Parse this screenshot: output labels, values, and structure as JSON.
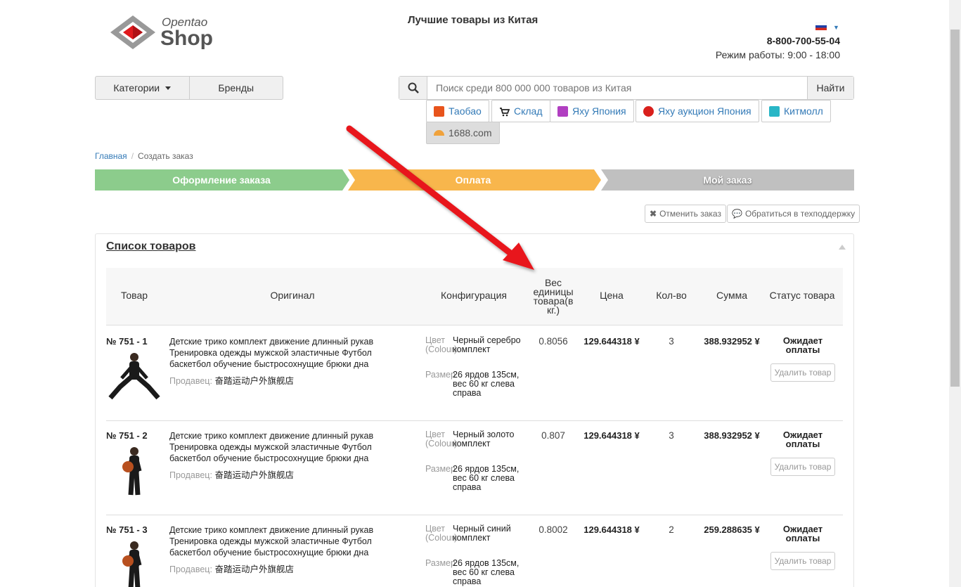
{
  "header": {
    "logo_top": "Opentao",
    "logo_main": "Shop",
    "tagline": "Лучшие товары из Китая",
    "phone": "8-800-700-55-04",
    "hours": "Режим работы: 9:00 - 18:00"
  },
  "nav": {
    "categories": "Категории",
    "brands": "Бренды"
  },
  "search": {
    "placeholder": "Поиск среди 800 000 000 товаров из Китая",
    "button": "Найти"
  },
  "sources": [
    {
      "label": "Таобао",
      "color": "#e8541c"
    },
    {
      "label": "Склад",
      "color": "#333333"
    },
    {
      "label": "Яху Япония",
      "color": "#b13fc1"
    },
    {
      "label": "Яху аукцион Япония",
      "color": "#d9201c"
    },
    {
      "label": "Китмолл",
      "color": "#29b6c6"
    },
    {
      "label": "1688.com",
      "color": "#f0a23c"
    }
  ],
  "breadcrumb": {
    "home": "Главная",
    "current": "Создать заказ"
  },
  "steps": [
    {
      "label": "Оформление заказа",
      "color": "#8ccc8c"
    },
    {
      "label": "Оплата",
      "color": "#f8b64c"
    },
    {
      "label": "Мой заказ",
      "color": "#c0c0c0"
    }
  ],
  "actions": {
    "cancel": "Отменить заказ",
    "support": "Обратиться в техподдержку"
  },
  "panel": {
    "title": "Список товаров"
  },
  "table": {
    "headers": {
      "item": "Товар",
      "original": "Оригинал",
      "config": "Конфигурация",
      "weight": "Вес единицы товара(в кг.)",
      "price": "Цена",
      "qty": "Кол-во",
      "sum": "Сумма",
      "status": "Статус товара"
    },
    "color_label": "Цвет (Colour):",
    "size_label": "Размер:",
    "seller_label": "Продавец:",
    "rows": [
      {
        "id": "№ 751 - 1",
        "title": "Детские трико комплект движение длинный рукав Тренировка одежды мужской эластичные Футбол баскетбол обучение быстросохнущие брюки дна",
        "seller": "奋踏运动户外旗舰店",
        "color": "Черный серебро комплект",
        "size": "26 ярдов 135см, вес 60 кг слева справа",
        "weight": "0.8056",
        "price": "129.644318 ¥",
        "qty": "3",
        "sum": "388.932952 ¥",
        "status": "Ожидает оплаты",
        "delete": "Удалить товар"
      },
      {
        "id": "№ 751 - 2",
        "title": "Детские трико комплект движение длинный рукав Тренировка одежды мужской эластичные Футбол баскетбол обучение быстросохнущие брюки дна",
        "seller": "奋踏运动户外旗舰店",
        "color": "Черный золото комплект",
        "size": "26 ярдов 135см, вес 60 кг слева справа",
        "weight": "0.807",
        "price": "129.644318 ¥",
        "qty": "3",
        "sum": "388.932952 ¥",
        "status": "Ожидает оплаты",
        "delete": "Удалить товар"
      },
      {
        "id": "№ 751 - 3",
        "title": "Детские трико комплект движение длинный рукав Тренировка одежды мужской эластичные Футбол баскетбол обучение быстросохнущие брюки дна",
        "seller": "奋踏运动户外旗舰店",
        "color": "Черный синий комплект",
        "size": "26 ярдов 135см, вес 60 кг слева справа",
        "weight": "0.8002",
        "price": "129.644318 ¥",
        "qty": "2",
        "sum": "259.288635 ¥",
        "status": "Ожидает оплаты",
        "delete": "Удалить товар"
      }
    ]
  },
  "annotation": {
    "arrow_color": "#e8171c"
  }
}
